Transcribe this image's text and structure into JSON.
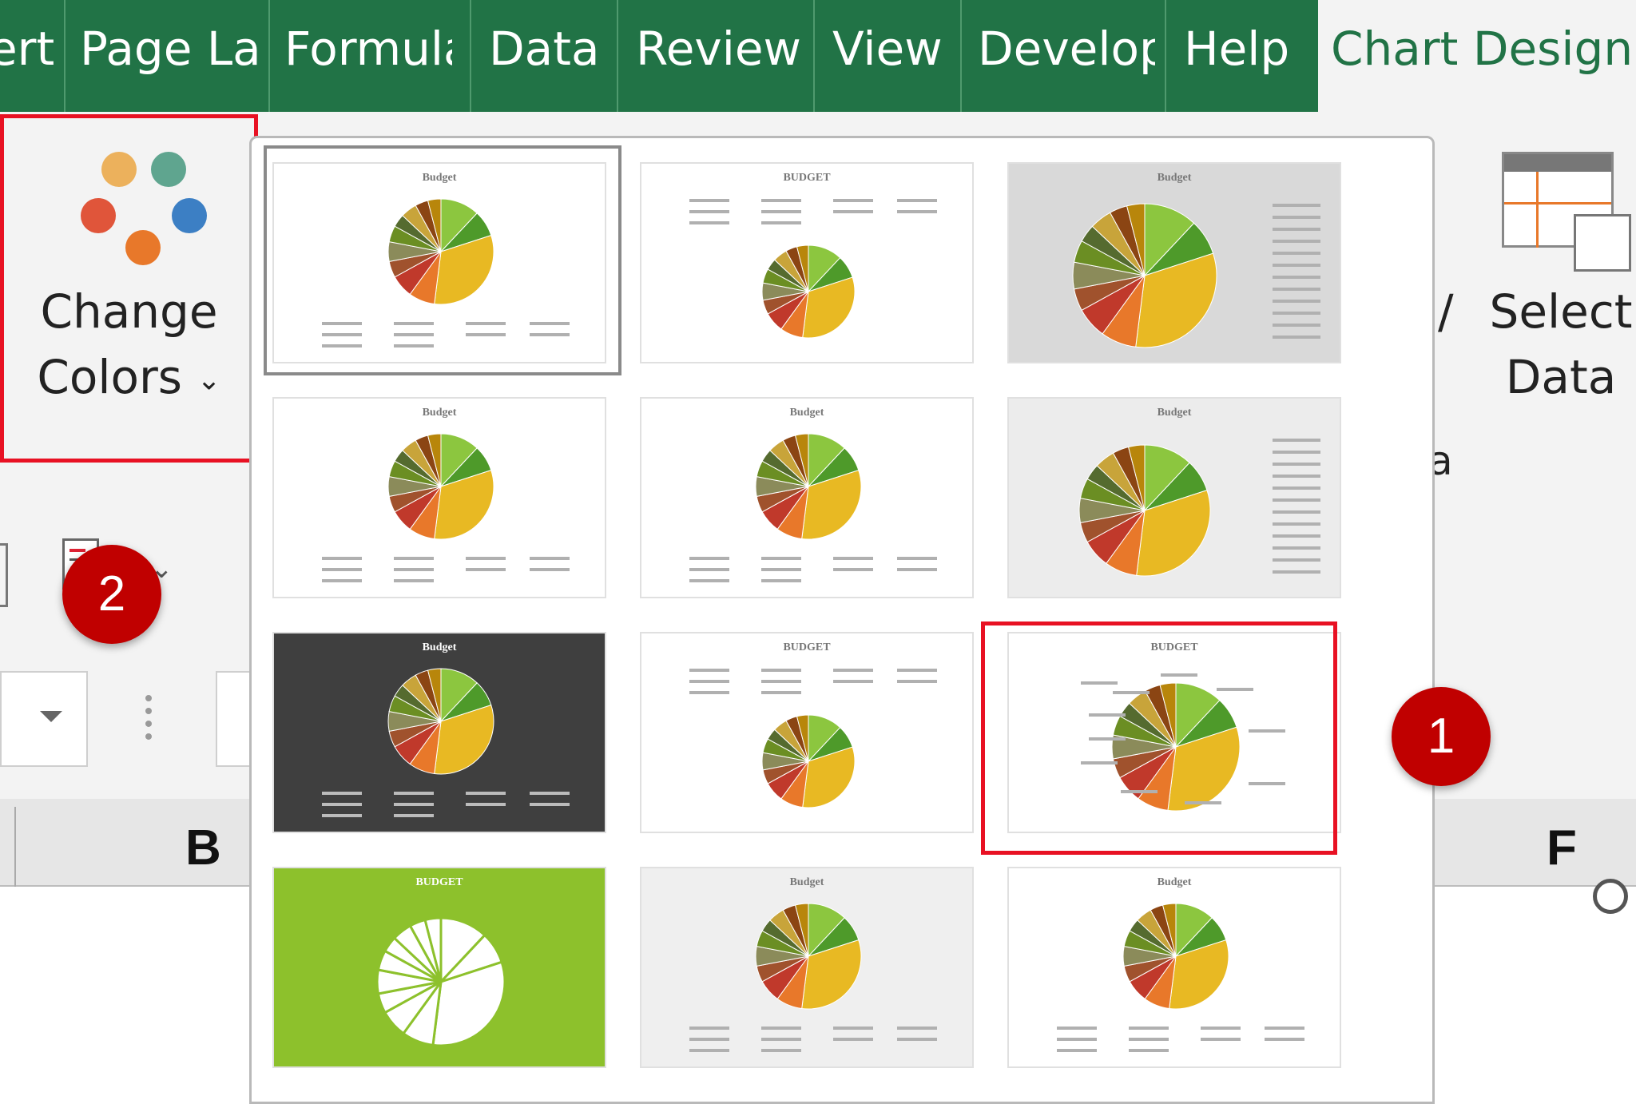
{
  "tabs": [
    "ert",
    "Page La",
    "Formula",
    "Data",
    "Review",
    "View",
    "Develop",
    "Help"
  ],
  "active_tab": "Chart Design",
  "change_colors": {
    "line1": "Change",
    "line2": "Colors",
    "dot_colors": [
      "#ecb15c",
      "#5fa58f",
      "#e0553a",
      "#3c7fc4",
      "#e8782a"
    ]
  },
  "select_data": {
    "line1": "Select",
    "line2": "Data",
    "partial_left": "/",
    "partial_below": "a"
  },
  "column_headers": {
    "b": "B",
    "f": "F"
  },
  "badges": {
    "one": "1",
    "two": "2"
  },
  "gallery": {
    "styles": [
      {
        "title": "Budget",
        "bg": "#ffffff",
        "legend": "bottom"
      },
      {
        "title": "BUDGET",
        "bg": "#ffffff",
        "legend": "top"
      },
      {
        "title": "Budget",
        "bg": "#d9d9d9",
        "legend": "right"
      },
      {
        "title": "Budget",
        "bg": "#ffffff",
        "legend": "bottom"
      },
      {
        "title": "Budget",
        "bg": "#ffffff",
        "legend": "bottom"
      },
      {
        "title": "Budget",
        "bg": "#ececec",
        "legend": "right"
      },
      {
        "title": "Budget",
        "bg": "#3f3f3f",
        "legend": "bottom"
      },
      {
        "title": "BUDGET",
        "bg": "#ffffff",
        "legend": "top"
      },
      {
        "title": "BUDGET",
        "bg": "#ffffff",
        "legend": "labels"
      },
      {
        "title": "BUDGET",
        "bg": "#8dc12c",
        "legend": "labels"
      },
      {
        "title": "Budget",
        "bg": "#efefef",
        "legend": "bottom"
      },
      {
        "title": "Budget",
        "bg": "#ffffff",
        "legend": "bottom"
      }
    ],
    "slice_colors": [
      "#8cc63f",
      "#4e9a2a",
      "#e8b923",
      "#e8782a",
      "#c0392b",
      "#a0522d",
      "#8b8b5a",
      "#6b8e23",
      "#556b2f",
      "#c8a43a",
      "#8b4513",
      "#b8860b"
    ]
  }
}
